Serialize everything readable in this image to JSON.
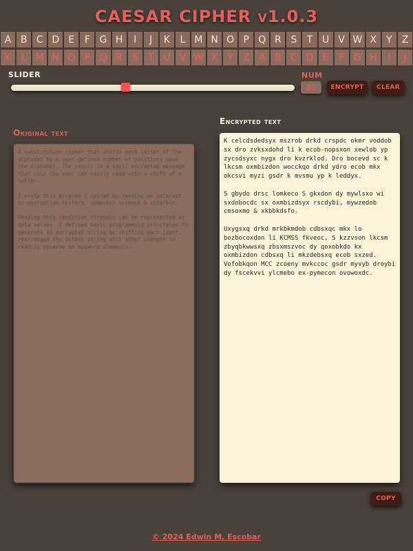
{
  "app": {
    "title": "CAESAR CIPHER v1.0.3"
  },
  "alphabet": {
    "plain": [
      "A",
      "B",
      "C",
      "D",
      "E",
      "F",
      "G",
      "H",
      "I",
      "J",
      "K",
      "L",
      "M",
      "N",
      "O",
      "P",
      "Q",
      "R",
      "S",
      "T",
      "U",
      "V",
      "W",
      "X",
      "Y",
      "Z"
    ],
    "shifted": [
      "K",
      "L",
      "M",
      "N",
      "O",
      "P",
      "Q",
      "R",
      "S",
      "T",
      "U",
      "V",
      "W",
      "X",
      "Y",
      "Z",
      "A",
      "B",
      "C",
      "D",
      "E",
      "F",
      "G",
      "H",
      "I",
      "J"
    ]
  },
  "controls": {
    "slider_label": "SLIDER",
    "slider_value": 10,
    "slider_min": 0,
    "slider_max": 25,
    "num_label": "NUM",
    "num_value": "10",
    "encrypt_label": "ENCRYPT",
    "clear_label": "CLEAR",
    "copy_label": "COPY"
  },
  "panels": {
    "original_label": "Original text",
    "original_text": "A substitution cipher that shifts each letter of the alphabet by a user-defined number of positions down the alphabet. The result is a basic encrypted message that only the user can easily read with a shift of a letter.\n\nI wrote this program I spired by reading an interest in encryption history, computer science & cyberbit.\n\nReading this rendition strongly can be represented as data values. I defined basic programming principles to generate an encrypted string by shifting each input, rearranged the output string with other changes to readily observe an keyword elements.",
    "encrypted_label": "Encrypted text",
    "encrypted_text": "K celcdsdedsyx mszrob drkd crspdc okmr voddob sx dro zvksxdohd li k ecob-nopsxon xewlob yp zycsdsyxc nygx dro kvzrklod. Dro bocevd sc k lkcsm oxmbizdon wocckqo drkd ydro ecob mkx okcsvi myzi gsdr k mvsmu yp k leddyx.\n\nS gbydo drsc lomkeco S gkxdon dy mywlsxo wi sxdobocdc sx oxmbizdsyx rscdybi, mywzedob cmsoxmo & xkbbkdsfo.\n\nUxygsxq drkd mrkbkmdob cdbsxqc mkx lo bozbocoxdon li KCMSS fkveoc, S kzzvson lkcsm zbyqbkwwsxq zbsxmszvoc dy qoxobkdo kx oxmbizdon cdbsxq li mkzdebsxq ecob sxzed. Vofobkqon MCC zcoeny mvkccoc gsdr myvyb droybi dy fscekvvi ylcmebo ex-pymecon ovowoxdc."
  },
  "footer": {
    "text": "© 2024 Edwin M. Escobar"
  },
  "colors": {
    "background": "#4a413a",
    "accent": "#e35f5c",
    "cell_bg": "#8a6a5c",
    "editor_bg": "#fbf3da"
  }
}
